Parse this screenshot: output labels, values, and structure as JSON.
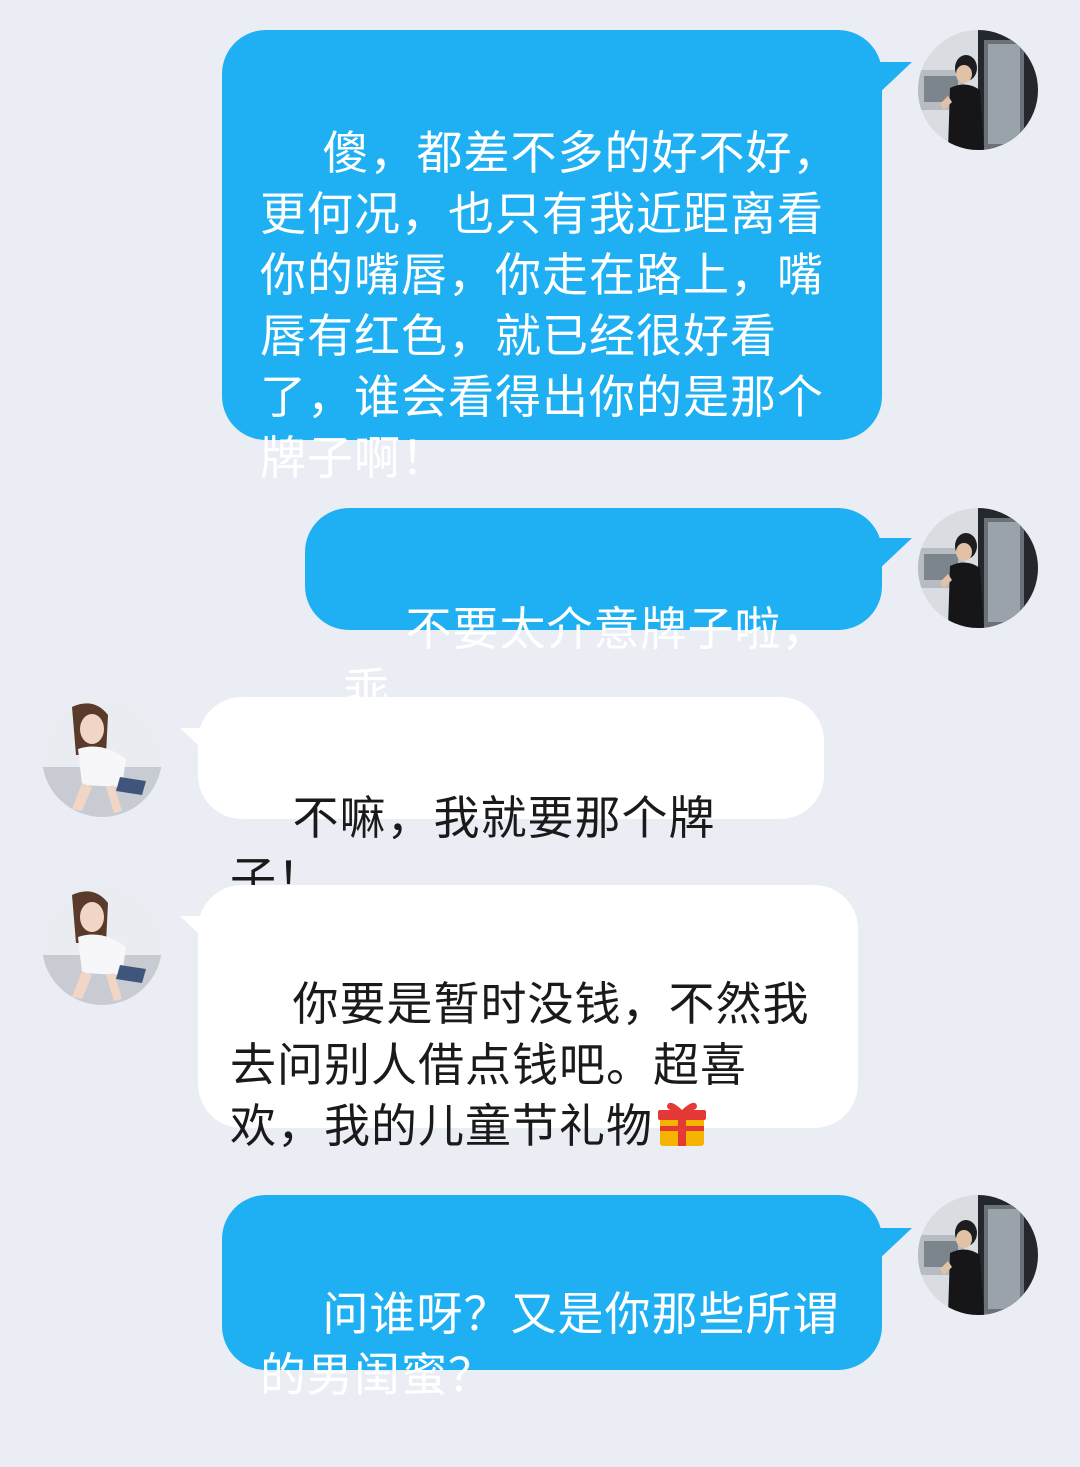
{
  "messages": [
    {
      "side": "right",
      "text": "傻，都差不多的好不好，更何况，也只有我近距离看你的嘴唇，你走在路上，嘴唇有红色，就已经很好看了，谁会看得出你的是那个牌子啊！",
      "avatar": "avatar-boy"
    },
    {
      "side": "right",
      "text": "不要太介意牌子啦，乖",
      "avatar": "avatar-boy"
    },
    {
      "side": "left",
      "text": "不嘛，我就要那个牌子！",
      "avatar": "avatar-girl"
    },
    {
      "side": "left",
      "text": "你要是暂时没钱，不然我去问别人借点钱吧。超喜欢，我的儿童节礼物",
      "emoji": "gift-icon",
      "avatar": "avatar-girl"
    },
    {
      "side": "right",
      "text": "问谁呀？又是你那些所谓的男闺蜜？",
      "avatar": "avatar-boy"
    }
  ],
  "colors": {
    "background": "#eaedf4",
    "sent_bubble": "#1fb0f4",
    "received_bubble": "#ffffff"
  }
}
